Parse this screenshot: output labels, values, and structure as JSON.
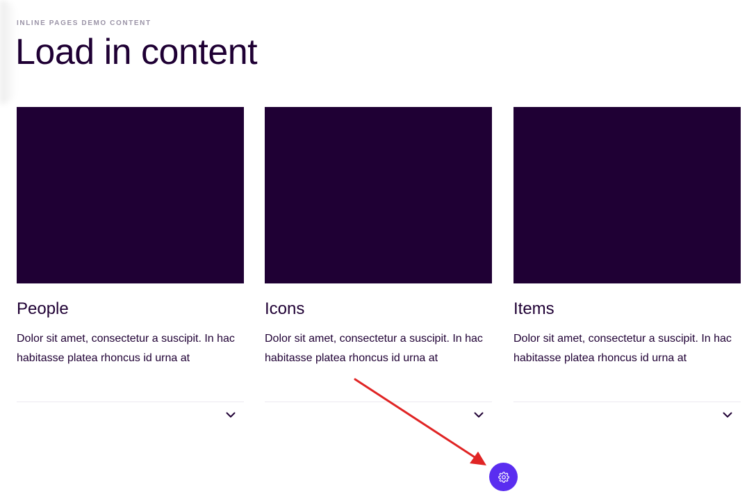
{
  "header": {
    "eyebrow": "INLINE PAGES DEMO CONTENT",
    "title": "Load in content"
  },
  "cards": [
    {
      "heading": "People",
      "description": "Dolor sit amet, consectetur a suscipit. In hac habitasse platea rhoncus id urna at"
    },
    {
      "heading": "Icons",
      "description": "Dolor sit amet, consectetur a suscipit. In hac habitasse platea rhoncus id urna at"
    },
    {
      "heading": "Items",
      "description": "Dolor sit amet, consectetur a suscipit. In hac habitasse platea rhoncus id urna at"
    }
  ],
  "colors": {
    "dark_purple": "#1f0034",
    "accent": "#5a2df0",
    "annotation_arrow": "#e02424"
  },
  "icons": {
    "card_toggle": "chevron-down-icon",
    "fab": "gear-icon"
  }
}
